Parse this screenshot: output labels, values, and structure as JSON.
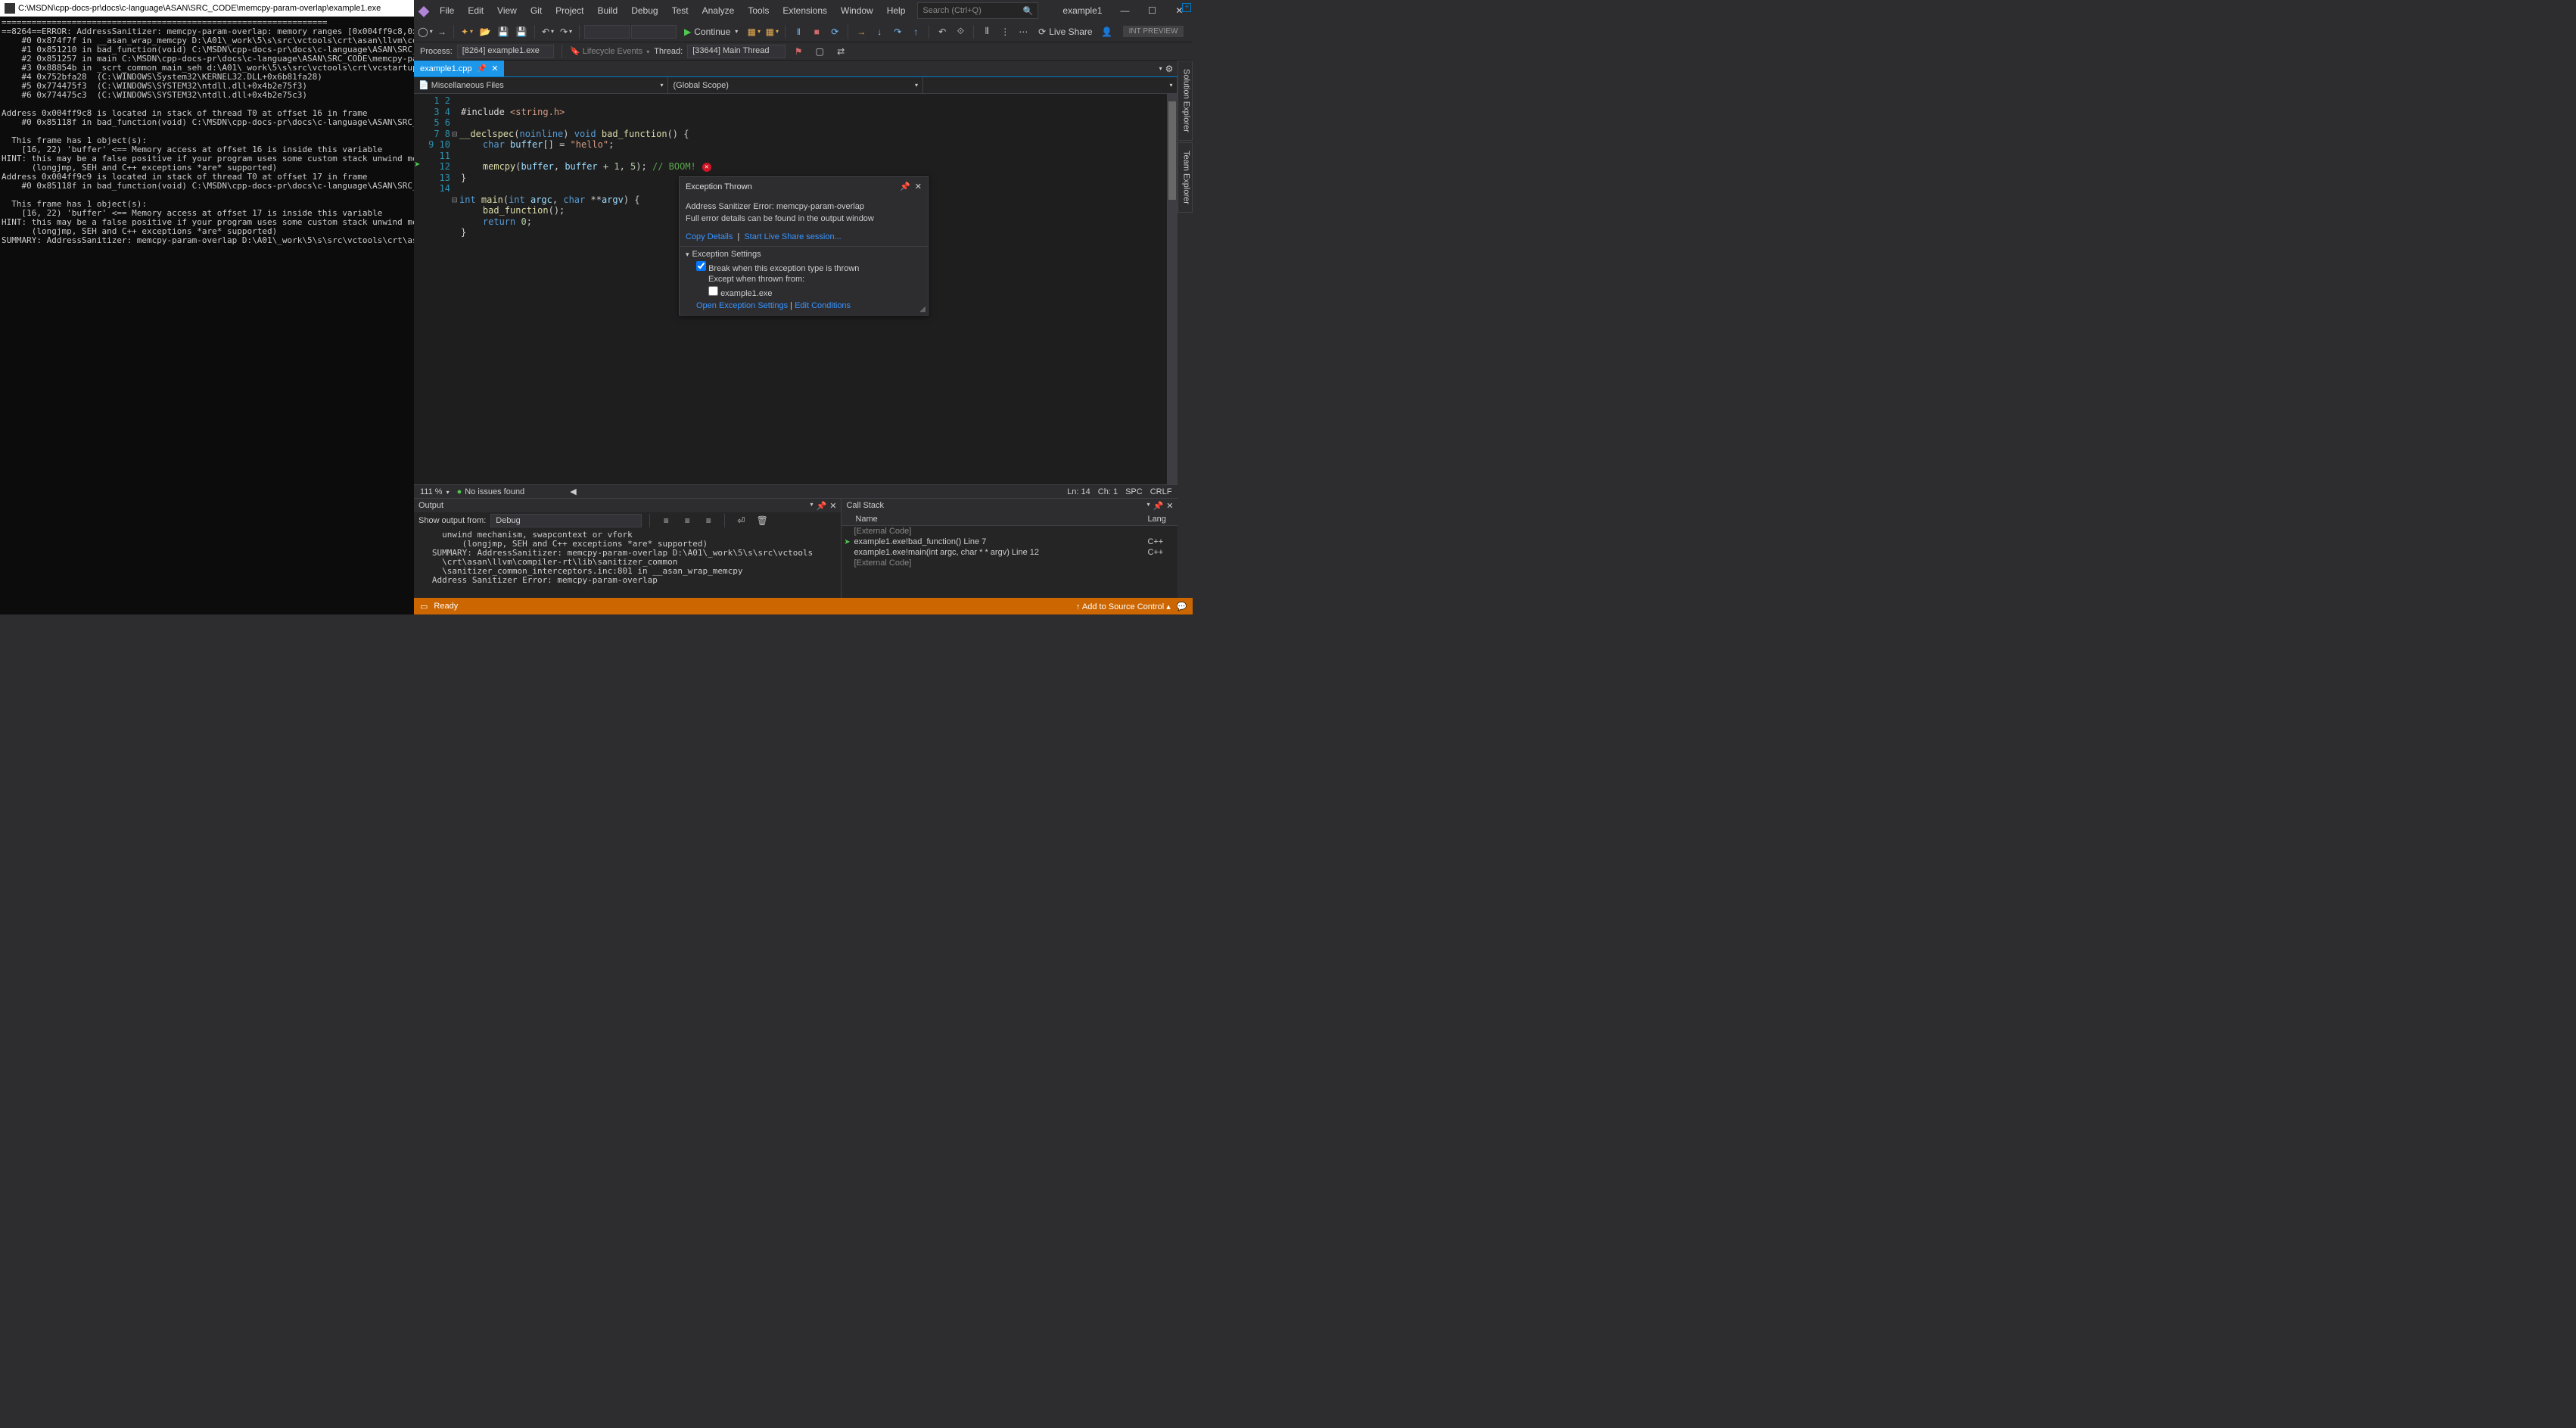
{
  "console": {
    "title": "C:\\MSDN\\cpp-docs-pr\\docs\\c-language\\ASAN\\SRC_CODE\\memcpy-param-overlap\\example1.exe",
    "body": "=================================================================\n==8264==ERROR: AddressSanitizer: memcpy-param-overlap: memory ranges [0x004ff9c8,0x004ff9cd) and [\n    #0 0x874f7f in __asan_wrap_memcpy D:\\A01\\_work\\5\\s\\src\\vctools\\crt\\asan\\llvm\\compiler-rt\\lib\\s\n    #1 0x851210 in bad_function(void) C:\\MSDN\\cpp-docs-pr\\docs\\c-language\\ASAN\\SRC_CODE\\memcpy-par\n    #2 0x851257 in main C:\\MSDN\\cpp-docs-pr\\docs\\c-language\\ASAN\\SRC_CODE\\memcpy-param-overlap\\exa\n    #3 0x88854b in _scrt_common_main_seh d:\\A01\\_work\\5\\s\\src\\vctools\\crt\\vcstartup\\src\\startup\\ex\n    #4 0x752bfa28  (C:\\WINDOWS\\System32\\KERNEL32.DLL+0x6b81fa28)\n    #5 0x774475f3  (C:\\WINDOWS\\SYSTEM32\\ntdll.dll+0x4b2e75f3)\n    #6 0x774475c3  (C:\\WINDOWS\\SYSTEM32\\ntdll.dll+0x4b2e75c3)\n\nAddress 0x004ff9c8 is located in stack of thread T0 at offset 16 in frame\n    #0 0x85118f in bad_function(void) C:\\MSDN\\cpp-docs-pr\\docs\\c-language\\ASAN\\SRC_CODE\\memcpy-par\n\n  This frame has 1 object(s):\n    [16, 22) 'buffer' <== Memory access at offset 16 is inside this variable\nHINT: this may be a false positive if your program uses some custom stack unwind mechanism, swapco\n      (longjmp, SEH and C++ exceptions *are* supported)\nAddress 0x004ff9c9 is located in stack of thread T0 at offset 17 in frame\n    #0 0x85118f in bad_function(void) C:\\MSDN\\cpp-docs-pr\\docs\\c-language\\ASAN\\SRC_CODE\\memcpy-par\n\n  This frame has 1 object(s):\n    [16, 22) 'buffer' <== Memory access at offset 17 is inside this variable\nHINT: this may be a false positive if your program uses some custom stack unwind mechanism, swapco\n      (longjmp, SEH and C++ exceptions *are* supported)\nSUMMARY: AddressSanitizer: memcpy-param-overlap D:\\A01\\_work\\5\\s\\src\\vctools\\crt\\asan\\llvm\\compile"
  },
  "menu": {
    "items": [
      "File",
      "Edit",
      "View",
      "Git",
      "Project",
      "Build",
      "Debug",
      "Test",
      "Analyze",
      "Tools",
      "Extensions",
      "Window",
      "Help"
    ]
  },
  "search_placeholder": "Search (Ctrl+Q)",
  "solution_name": "example1",
  "continue_label": "Continue",
  "liveshare_label": "Live Share",
  "int_preview": "INT PREVIEW",
  "debug": {
    "process_label": "Process:",
    "process_value": "[8264] example1.exe",
    "lifecycle": "Lifecycle Events",
    "thread_label": "Thread:",
    "thread_value": "[33644] Main Thread"
  },
  "side_tabs": [
    "Solution Explorer",
    "Team Explorer"
  ],
  "file_tab": {
    "name": "example1.cpp"
  },
  "nav": {
    "project": "Miscellaneous Files",
    "scope": "(Global Scope)",
    "member": ""
  },
  "status_editor": {
    "zoom": "111 %",
    "issues": "No issues found",
    "ln": "Ln: 14",
    "ch": "Ch: 1",
    "spc": "SPC",
    "crlf": "CRLF"
  },
  "popup": {
    "title": "Exception Thrown",
    "line1": "Address Sanitizer Error: memcpy-param-overlap",
    "line2": "Full error details can be found in the output window",
    "copy": "Copy Details",
    "start_ls": "Start Live Share session...",
    "settings_header": "Exception Settings",
    "break_label": "Break when this exception type is thrown",
    "except_label": "Except when thrown from:",
    "except_item": "example1.exe",
    "open_settings": "Open Exception Settings",
    "edit_cond": "Edit Conditions"
  },
  "output": {
    "title": "Output",
    "show_label": "Show output from:",
    "show_value": "Debug",
    "body": "     unwind mechanism, swapcontext or vfork\n         (longjmp, SEH and C++ exceptions *are* supported)\n   SUMMARY: AddressSanitizer: memcpy-param-overlap D:\\A01\\_work\\5\\s\\src\\vctools\n     \\crt\\asan\\llvm\\compiler-rt\\lib\\sanitizer_common\n     \\sanitizer_common_interceptors.inc:801 in __asan_wrap_memcpy\n   Address Sanitizer Error: memcpy-param-overlap"
  },
  "callstack": {
    "title": "Call Stack",
    "col_name": "Name",
    "col_lang": "Lang",
    "rows": [
      {
        "icon": "",
        "name": "[External Code]",
        "lang": "",
        "gray": true
      },
      {
        "icon": "▶",
        "name": "example1.exe!bad_function() Line 7",
        "lang": "C++",
        "gray": false
      },
      {
        "icon": "",
        "name": "example1.exe!main(int argc, char * * argv) Line 12",
        "lang": "C++",
        "gray": false
      },
      {
        "icon": "",
        "name": "[External Code]",
        "lang": "",
        "gray": true
      }
    ]
  },
  "statusbar": {
    "ready": "Ready",
    "source_control": "Add to Source Control"
  }
}
